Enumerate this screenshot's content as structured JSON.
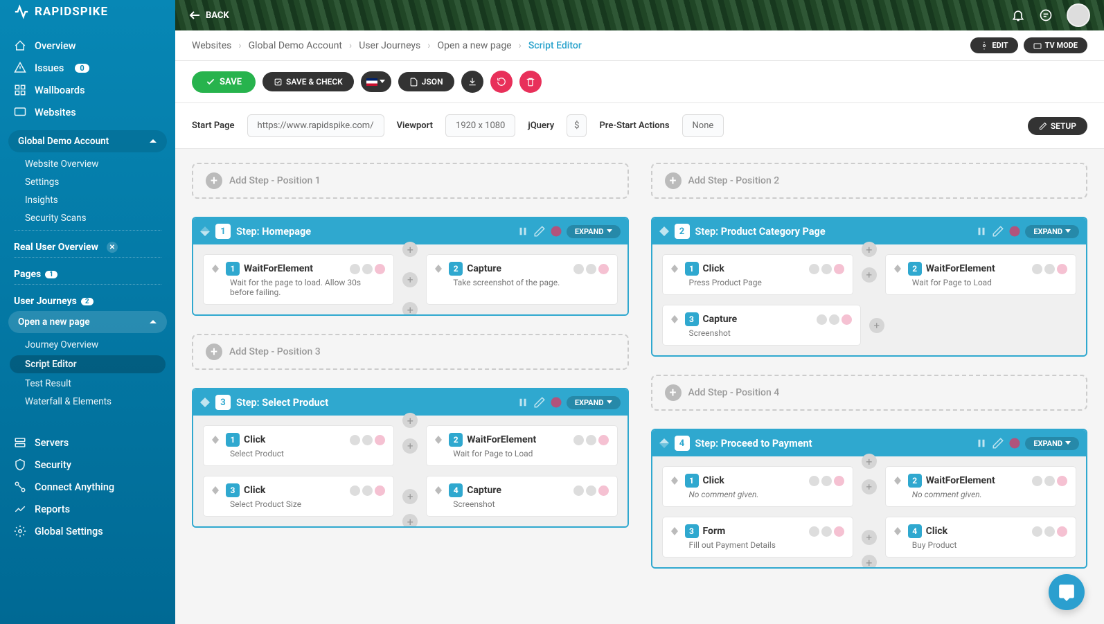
{
  "logo": "RAPIDSPIKE",
  "nav": {
    "overview": "Overview",
    "issues": "Issues",
    "issues_badge": "0",
    "wallboards": "Wallboards",
    "websites": "Websites",
    "account": "Global Demo Account",
    "website_overview": "Website Overview",
    "settings": "Settings",
    "insights": "Insights",
    "security_scans": "Security Scans",
    "real_user": "Real User Overview",
    "pages": "Pages",
    "pages_badge": "1",
    "user_journeys": "User Journeys",
    "uj_badge": "2",
    "open_page": "Open a new page",
    "journey_overview": "Journey Overview",
    "script_editor": "Script Editor",
    "test_result": "Test Result",
    "waterfall": "Waterfall & Elements",
    "servers": "Servers",
    "security": "Security",
    "connect": "Connect Anything",
    "reports": "Reports",
    "global_settings": "Global Settings"
  },
  "hero": {
    "back": "BACK"
  },
  "crumbs": {
    "websites": "Websites",
    "account": "Global Demo Account",
    "uj": "User Journeys",
    "open": "Open a new page",
    "current": "Script Editor"
  },
  "mode": {
    "edit": "EDIT",
    "tv": "TV MODE"
  },
  "toolbar": {
    "save": "SAVE",
    "save_check": "SAVE & CHECK",
    "json": "JSON"
  },
  "config": {
    "start_label": "Start Page",
    "start_val": "https://www.rapidspike.com/",
    "viewport_label": "Viewport",
    "viewport_val": "1920 x 1080",
    "jquery_label": "jQuery",
    "jquery_val": "$",
    "prestart_label": "Pre-Start Actions",
    "prestart_val": "None",
    "setup": "SETUP"
  },
  "add_steps": {
    "p1": "Add Step - Position 1",
    "p2": "Add Step - Position 2",
    "p3": "Add Step - Position 3",
    "p4": "Add Step - Position 4"
  },
  "expand": "EXPAND",
  "steps": [
    {
      "num": "1",
      "label": "Step:",
      "name": "Homepage",
      "actions": [
        {
          "num": "1",
          "title": "WaitForElement",
          "desc": "Wait for the page to load. Allow 30s before failing."
        },
        {
          "num": "2",
          "title": "Capture",
          "desc": "Take screenshot of the page."
        }
      ]
    },
    {
      "num": "2",
      "label": "Step:",
      "name": "Product Category Page",
      "actions": [
        {
          "num": "1",
          "title": "Click",
          "desc": "Press Product Page"
        },
        {
          "num": "2",
          "title": "WaitForElement",
          "desc": "Wait for Page to Load"
        },
        {
          "num": "3",
          "title": "Capture",
          "desc": "Screenshot"
        }
      ]
    },
    {
      "num": "3",
      "label": "Step:",
      "name": "Select Product",
      "actions": [
        {
          "num": "1",
          "title": "Click",
          "desc": "Select Product"
        },
        {
          "num": "2",
          "title": "WaitForElement",
          "desc": "Wait for Page to Load"
        },
        {
          "num": "3",
          "title": "Click",
          "desc": "Select Product Size"
        },
        {
          "num": "4",
          "title": "Capture",
          "desc": "Screenshot"
        }
      ]
    },
    {
      "num": "4",
      "label": "Step:",
      "name": "Proceed to Payment",
      "actions": [
        {
          "num": "1",
          "title": "Click",
          "desc": "No comment given.",
          "italic": true
        },
        {
          "num": "2",
          "title": "WaitForElement",
          "desc": "No comment given.",
          "italic": true
        },
        {
          "num": "3",
          "title": "Form",
          "desc": "Fill out Payment Details"
        },
        {
          "num": "4",
          "title": "Click",
          "desc": "Buy Product"
        }
      ]
    }
  ]
}
